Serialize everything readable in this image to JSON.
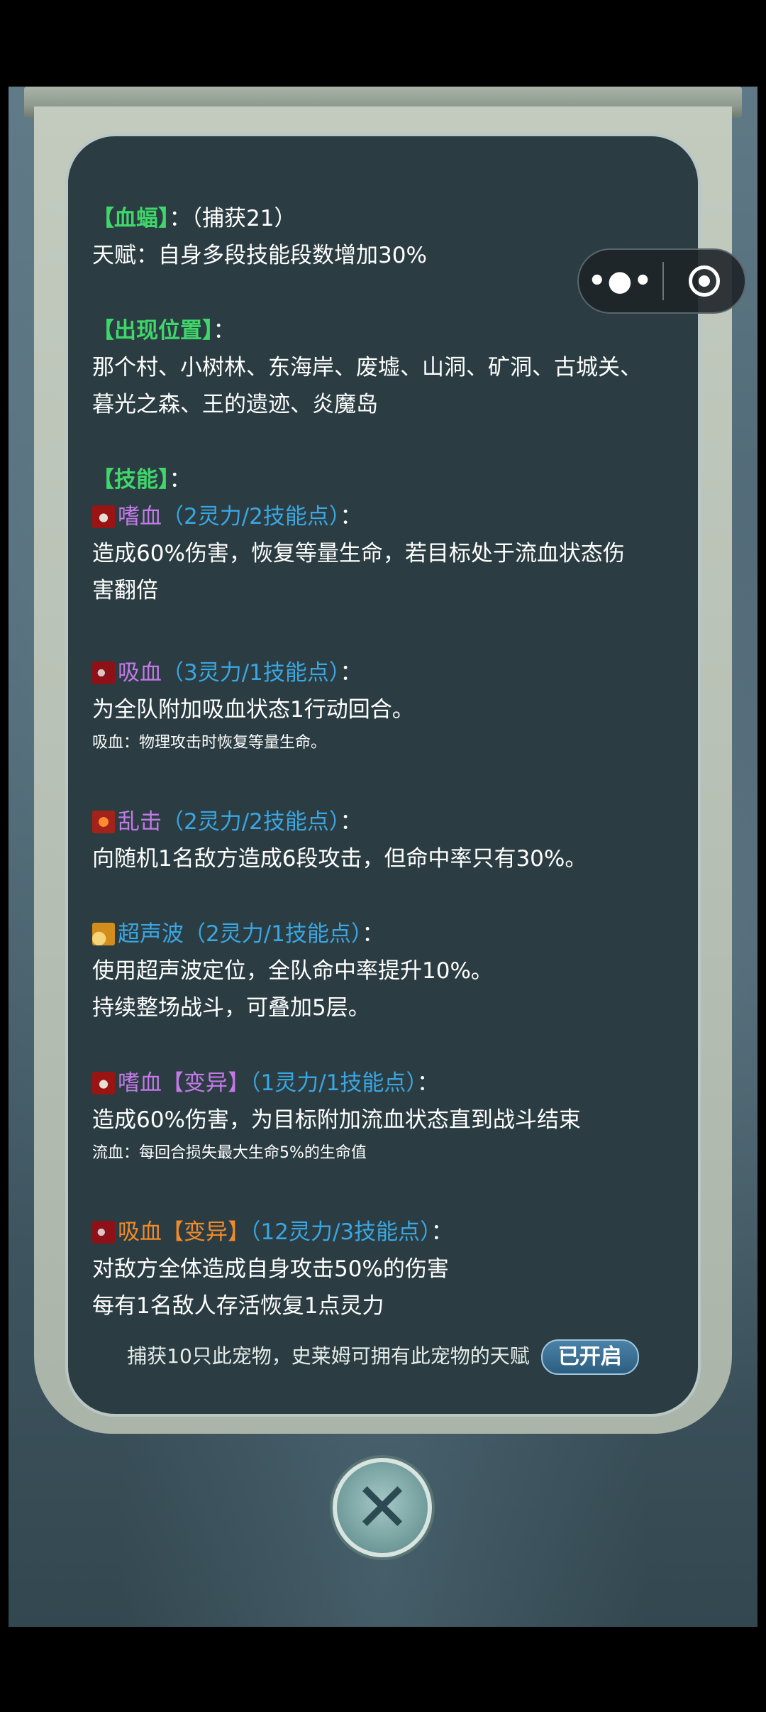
{
  "pet": {
    "name": "【血蝠】",
    "capture": "：（捕获21）"
  },
  "talent": "天赋：自身多段技能段数增加30%",
  "location": {
    "header": "【出现位置】",
    "lines": [
      "那个村、小树林、东海岸、废墟、山洞、矿洞、古城关、",
      "暮光之森、王的遗迹、炎魔岛"
    ]
  },
  "skills_header": "【技能】",
  "colon": "：",
  "skills": [
    {
      "icon": "blood-icon",
      "name": "嗜血",
      "cost": "（2灵力/2技能点）",
      "desc": [
        "造成60%伤害，恢复等量生命，若目标处于流血状态伤",
        "害翻倍"
      ]
    },
    {
      "icon": "vampire-bat-icon",
      "name": "吸血",
      "cost": "（3灵力/1技能点）",
      "desc": [
        "为全队附加吸血状态1行动回合。"
      ],
      "note": "吸血：物理攻击时恢复等量生命。"
    },
    {
      "icon": "chaos-strike-icon",
      "name": "乱击",
      "cost": "（2灵力/2技能点）",
      "desc": [
        "向随机1名敌方造成6段攻击，但命中率只有30%。"
      ]
    },
    {
      "icon": "ultrasonic-icon",
      "name": "超声波",
      "cost": "（2灵力/1技能点）",
      "desc": [
        "使用超声波定位，全队命中率提升10%。",
        "持续整场战斗，可叠加5层。"
      ]
    },
    {
      "icon": "blood-icon",
      "name": "嗜血",
      "tag": "【变异】",
      "cost": "（1灵力/1技能点）",
      "desc": [
        "造成60%伤害，为目标附加流血状态直到战斗结束"
      ],
      "note": "流血：每回合损失最大生命5%的生命值"
    },
    {
      "icon": "vampire-bat-icon",
      "name": "吸血",
      "tag": "【变异】",
      "cost": "（12灵力/3技能点）",
      "desc": [
        "对敌方全体造成自身攻击50%的伤害",
        "每有1名敌人存活恢复1点灵力"
      ]
    }
  ],
  "footer": {
    "text": "捕获10只此宠物，史莱姆可拥有此宠物的天赋",
    "badge": "已开启"
  },
  "close": "✕",
  "capsule": {
    "more": "•●•"
  },
  "colors": {
    "green": "#3fd66a",
    "blue": "#3aa6e2",
    "purple": "#c479e8",
    "orange": "#f08a2c",
    "panel": "#2b3d42"
  }
}
